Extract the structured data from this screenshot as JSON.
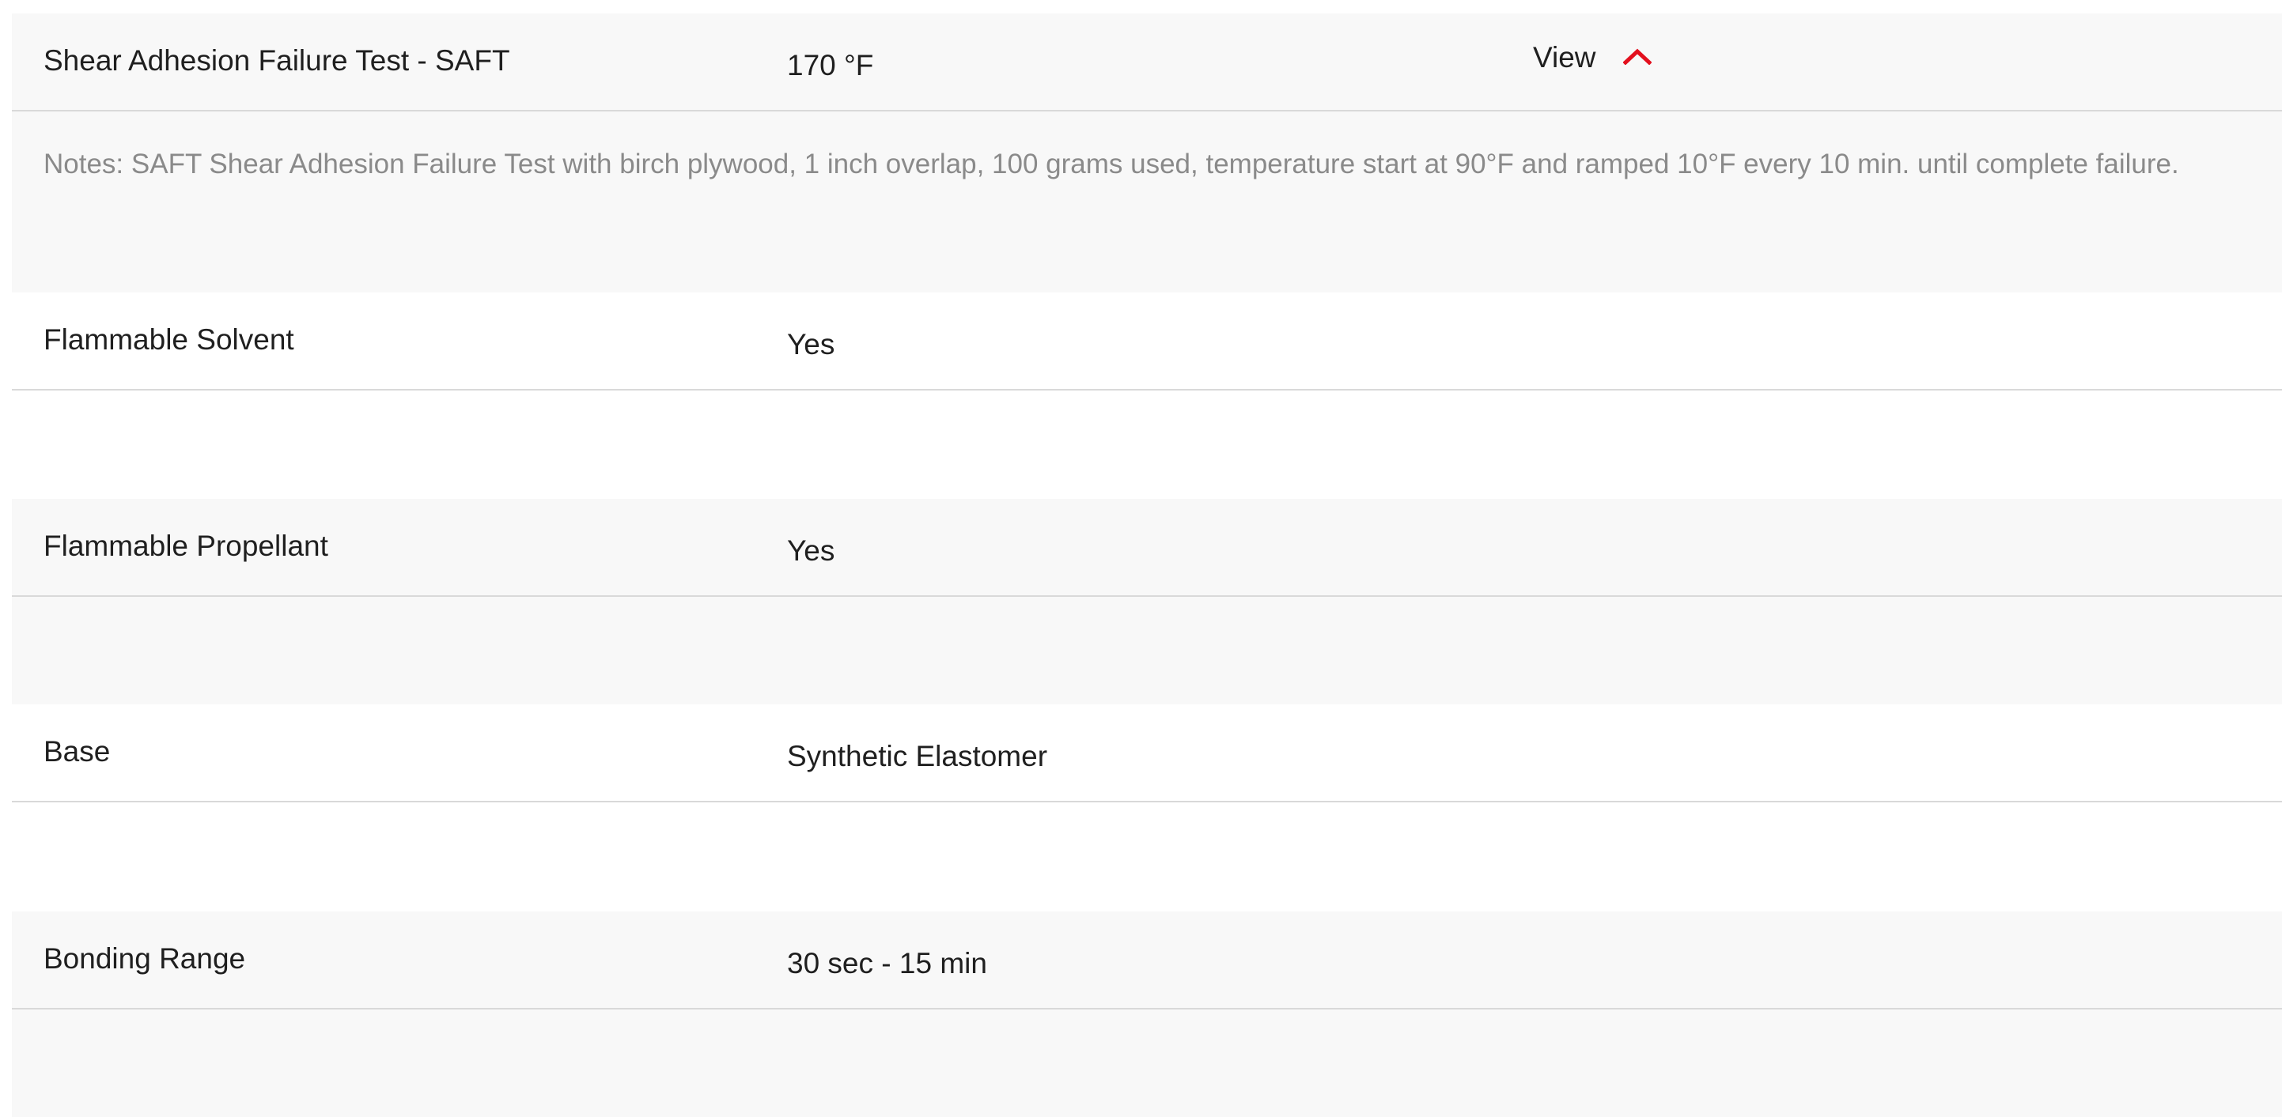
{
  "spec_rows": [
    {
      "label": "Shear Adhesion Failure Test - SAFT",
      "value": "170 °F",
      "toggle_label": "View",
      "toggle_icon": "chevron-up-icon",
      "expanded": true,
      "notes": "Notes: SAFT Shear Adhesion Failure Test with birch plywood, 1 inch overlap, 100 grams used, temperature start at 90°F and ramped 10°F every 10 min. until complete failure."
    },
    {
      "label": "Flammable Solvent",
      "value": "Yes"
    },
    {
      "label": "Flammable Propellant",
      "value": "Yes"
    },
    {
      "label": "Base",
      "value": "Synthetic Elastomer"
    },
    {
      "label": "Bonding Range",
      "value": "30 sec - 15 min"
    }
  ],
  "colors": {
    "accent": "#e3101e",
    "row_shaded": "#f8f8f8",
    "row_plain": "#ffffff",
    "divider": "#d9d9d9",
    "notes_text": "#8a8a8a",
    "text": "#1f1f1f"
  }
}
